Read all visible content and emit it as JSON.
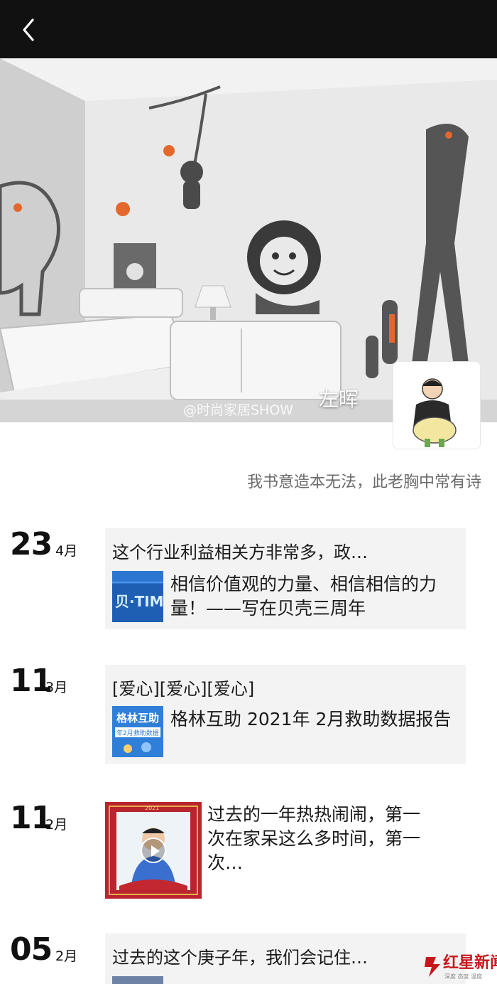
{
  "header": {
    "back_icon": "chevron-left-icon"
  },
  "cover": {
    "watermark": "@时尚家居SHOW"
  },
  "profile": {
    "name": "左晖",
    "signature": "我书意造本无法，此老胸中常有诗"
  },
  "posts": [
    {
      "day": "23",
      "month": "4月",
      "text": "这个行业利益相关方非常多，政…",
      "link_title": "相信价值观的力量、相信相信的力量！——写在贝壳三周年",
      "thumb_text": "贝壳·TIM"
    },
    {
      "day": "11",
      "month": "3月",
      "text": "[爱心][爱心][爱心]",
      "link_title": "格林互助 2021年 2月救助数据报告",
      "thumb_text": "格林互助",
      "thumb_sub": "年2月救助数据"
    },
    {
      "day": "11",
      "month": "2月",
      "video_text": "过去的一年热热闹闹，第一次在家呆这么多时间，第一次…",
      "thumb_year": "2021"
    },
    {
      "day": "05",
      "month": "2月",
      "text": "过去的这个庚子年，我们会记住…"
    }
  ],
  "brand": {
    "name": "红星新闻",
    "tagline": "深度 态度 温度",
    "color": "#c8161d"
  }
}
